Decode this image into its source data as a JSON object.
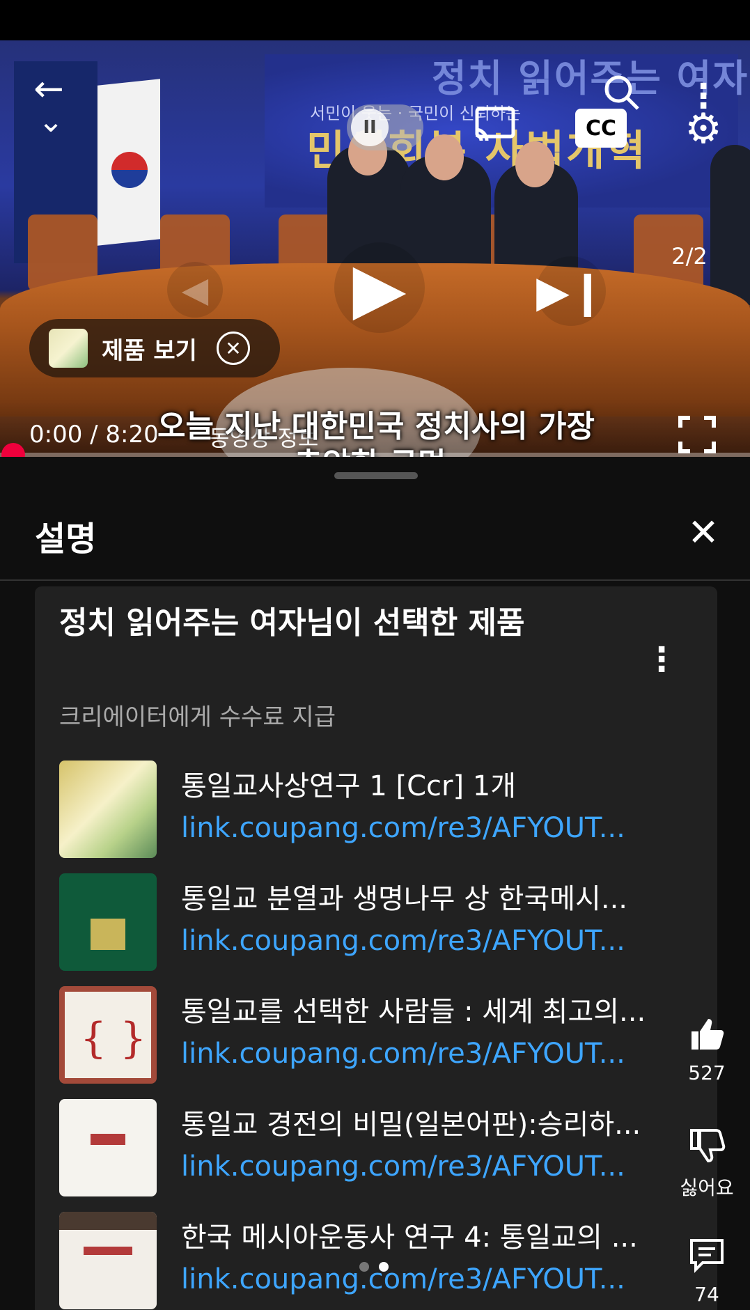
{
  "player": {
    "counter": "2/2",
    "time": "0:00 / 8:20",
    "chapter": "동영상 정보",
    "caption_line1": "오늘 지난 대한민국 정치사의 가장",
    "caption_line2": "추악한 구멍.",
    "product_chip_label": "제품 보기",
    "cc_label": "CC",
    "banner_text_1": "정치 읽어주는 여자",
    "banner_text_2": "민생회복 사법개혁",
    "banner_sub": "서민이 웃는 · 국민이 신뢰하는",
    "progress": 0.0
  },
  "description": {
    "title": "설명",
    "card": {
      "title": "정치 읽어주는 여자님이 선택한 제품",
      "subtitle": "크리에이터에게 수수료 지급"
    },
    "products": [
      {
        "title": "통일교사상연구 1 [Ccr] 1개",
        "link": "link.coupang.com/re3/AFYOUT..."
      },
      {
        "title": "통일교 분열과 생명나무 상 한국메시...",
        "link": "link.coupang.com/re3/AFYOUT..."
      },
      {
        "title": "통일교를 선택한 사람들 : 세계 최고의...",
        "link": "link.coupang.com/re3/AFYOUT..."
      },
      {
        "title": "통일교 경전의 비밀(일본어판):승리하...",
        "link": "link.coupang.com/re3/AFYOUT..."
      },
      {
        "title": "한국 메시아운동사 연구 4: 통일교의 ...",
        "link": "link.coupang.com/re3/AFYOUT..."
      }
    ]
  },
  "actions": {
    "like_count": "527",
    "dislike_label": "싫어요",
    "comment_count": "74"
  },
  "colors": {
    "accent_red": "#f0003c",
    "link_blue": "#3ea6ff",
    "panel_bg": "#0f0f0f",
    "card_bg": "#212121"
  },
  "icons": [
    "back-arrow-icon",
    "collapse-chevron-icon",
    "pause-icon",
    "cast-icon",
    "cc-icon",
    "search-icon",
    "more-vertical-icon",
    "settings-gear-icon",
    "previous-icon",
    "play-icon",
    "next-icon",
    "close-circle-icon",
    "fullscreen-icon",
    "close-icon",
    "thumbs-up-icon",
    "thumbs-down-icon",
    "comment-icon"
  ]
}
